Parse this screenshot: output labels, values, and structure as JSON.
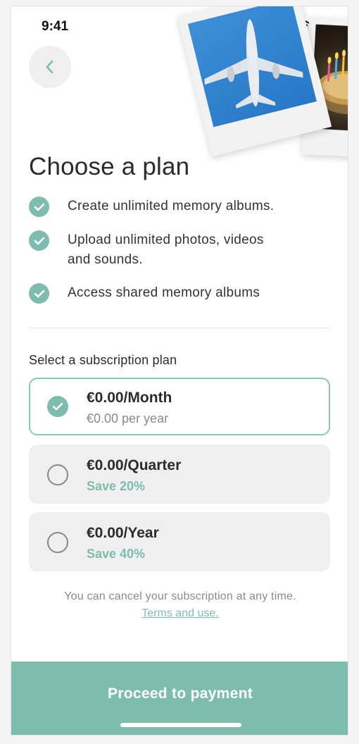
{
  "status_bar": {
    "time": "9:41"
  },
  "header": {
    "back_icon": "chevron-left-icon"
  },
  "photos": [
    {
      "subject": "airplane"
    },
    {
      "subject": "birthday-cake"
    }
  ],
  "title": "Choose a plan",
  "features": [
    {
      "text": "Create unlimited memory albums."
    },
    {
      "text": "Upload unlimited photos, videos and sounds."
    },
    {
      "text": "Access shared memory albums"
    }
  ],
  "subscription": {
    "label": "Select a subscription plan",
    "plans": [
      {
        "price": "€0.00/Month",
        "detail": "€0.00 per year",
        "selected": true
      },
      {
        "price": "€0.00/Quarter",
        "detail": "Save 20%",
        "selected": false
      },
      {
        "price": "€0.00/Year",
        "detail": "Save 40%",
        "selected": false
      }
    ]
  },
  "footer": {
    "cancel_note": "You can cancel your subscription at any time.",
    "terms_link": "Terms and use."
  },
  "cta": {
    "label": "Proceed to payment"
  },
  "colors": {
    "accent": "#7fbcb0",
    "accent_border": "#8ec4b8",
    "card_bg": "#efefef",
    "text": "#2b2b2b",
    "muted": "#8a8a8a"
  }
}
